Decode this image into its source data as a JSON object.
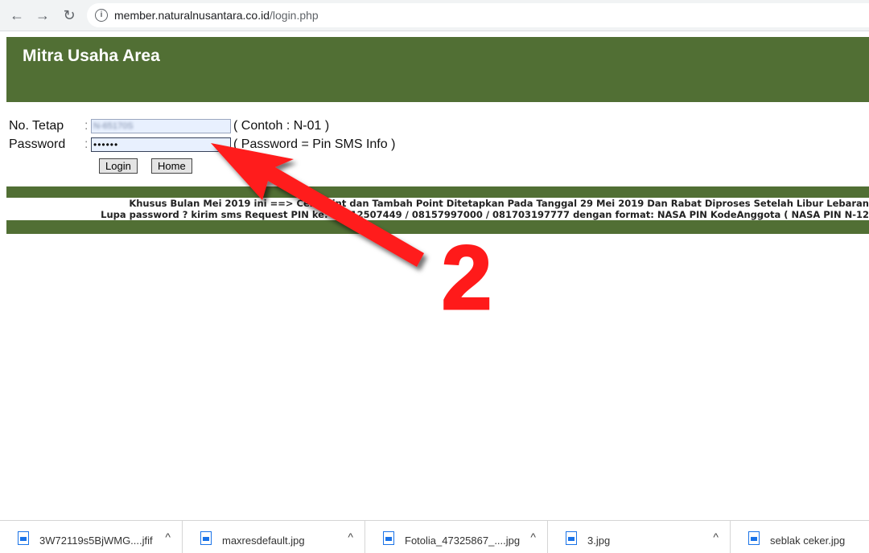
{
  "browser": {
    "back_icon": "←",
    "forward_icon": "→",
    "reload_icon": "↻",
    "info_icon": "i",
    "url_host": "member.naturalnusantara.co.id",
    "url_path": "/login.php"
  },
  "page": {
    "title": "Mitra Usaha Area",
    "form": {
      "no_tetap_label": "No. Tetap",
      "no_tetap_colon": ":",
      "no_tetap_value": "N-65170S",
      "no_tetap_hint": "( Contoh : N-01 )",
      "password_label": "Password",
      "password_colon": ":",
      "password_value": "••••••",
      "password_hint": "( Password = Pin SMS Info )",
      "login_button": "Login",
      "home_button": "Home"
    },
    "notice_line1": "Khusus Bulan Mei 2019 ini ==> Cek Point dan Tambah Point Ditetapkan Pada Tanggal 29 Mei 2019 Dan Rabat Diproses Setelah Libur Lebaran",
    "notice_line2": "Lupa password ? kirim sms Request PIN ke: 08112507449 / 08157997000 / 081703197777 dengan format: NASA PIN KodeAnggota ( NASA PIN N-12"
  },
  "annotation": {
    "step_number": "2",
    "color": "#ff1a1a"
  },
  "downloads": [
    {
      "name": "3W72119s5BjWMG....jfif",
      "chevron": "^"
    },
    {
      "name": "maxresdefault.jpg",
      "chevron": "^"
    },
    {
      "name": "Fotolia_47325867_....jpg",
      "chevron": "^"
    },
    {
      "name": "3.jpg",
      "chevron": "^"
    },
    {
      "name": "seblak ceker.jpg",
      "chevron": ""
    }
  ]
}
